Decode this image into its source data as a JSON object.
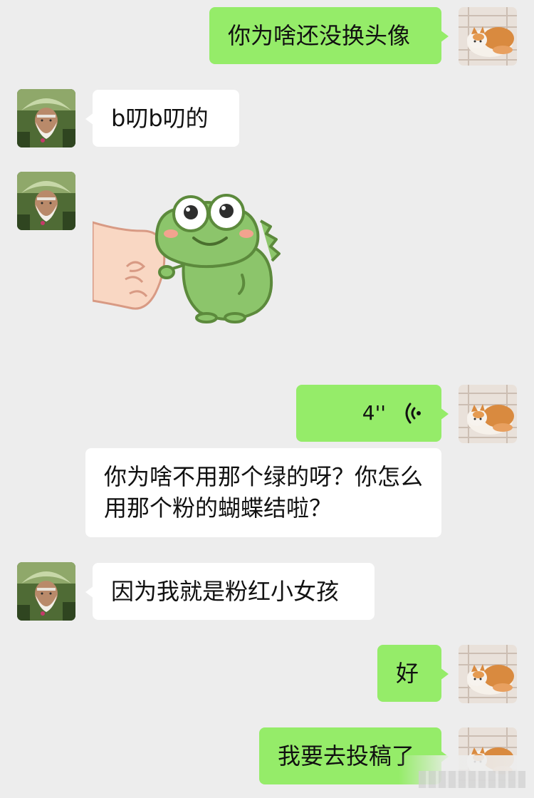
{
  "chat": {
    "messages": [
      {
        "sender": "me",
        "type": "text",
        "text": "你为啥还没换头像"
      },
      {
        "sender": "friend",
        "type": "text",
        "text": "b叨b叨的"
      },
      {
        "sender": "friend",
        "type": "sticker",
        "sticker": "frog-fist-bump"
      },
      {
        "sender": "me",
        "type": "voice",
        "duration": "4''"
      },
      {
        "sender": "quoted",
        "type": "text",
        "text": "你为啥不用那个绿的呀？你怎么用那个粉的蝴蝶结啦？"
      },
      {
        "sender": "friend",
        "type": "text",
        "text": "因为我就是粉红小女孩"
      },
      {
        "sender": "me",
        "type": "text",
        "text": "好"
      },
      {
        "sender": "me",
        "type": "text",
        "text": "我要去投稿了"
      }
    ]
  },
  "avatars": {
    "me": "cat-avatar",
    "friend": "old-man-avatar"
  },
  "colors": {
    "background": "#ededed",
    "my_bubble": "#95ec69",
    "friend_bubble": "#ffffff",
    "text": "#111111"
  }
}
